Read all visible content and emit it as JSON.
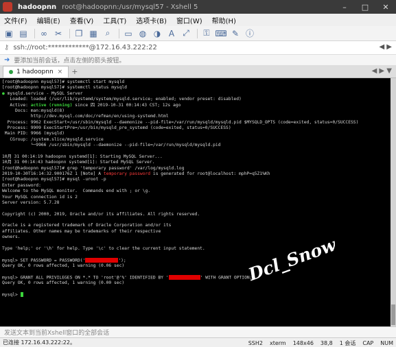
{
  "window": {
    "session": "hadoopnn",
    "title_path": "root@hadoopnn:/usr/mysql57 - Xshell 5",
    "controls": [
      "–",
      "□",
      "✕"
    ]
  },
  "menu": [
    "文件(F)",
    "编辑(E)",
    "查看(V)",
    "工具(T)",
    "选项卡(B)",
    "窗口(W)",
    "帮助(H)"
  ],
  "address": {
    "text": "ssh://root:************@172.16.43.222:22",
    "nav": "◀ ▶"
  },
  "hint": {
    "text": "要添加当前会话，点击左侧的箭头按钮。"
  },
  "tab": {
    "label": "1 hadoopnn",
    "close": "×",
    "add": "+",
    "nav": "◀ ▶ ▼"
  },
  "terminal": {
    "l1": "[root@hadoopnn mysql57]# systemctl start mysqld",
    "l2": "[root@hadoopnn mysql57]# systemctl status mysqld",
    "l3_dot": "●",
    "l3_rest": " mysqld.service - MySQL Server",
    "l4": "   Loaded: loaded (/usr/lib/systemd/system/mysqld.service; enabled; vendor preset: disabled)",
    "l5_a": "   Active: ",
    "l5_active": "active (running)",
    "l5_b": " since 四 2019-10-31 00:14:43 CST; 12s ago",
    "l6": "     Docs: man:mysqld(8)",
    "l7": "           http://dev.mysql.com/doc/refman/en/using-systemd.html",
    "l8": "  Process: 9962 ExecStart=/usr/sbin/mysqld --daemonize --pid-file=/var/run/mysqld/mysqld.pid $MYSQLD_OPTS (code=exited, status=0/SUCCESS)",
    "l9": "  Process: 9909 ExecStartPre=/usr/bin/mysqld_pre_systemd (code=exited, status=0/SUCCESS)",
    "l10": " Main PID: 9966 (mysqld)",
    "l11": "   CGroup: /system.slice/mysqld.service",
    "l12": "           └─9966 /usr/sbin/mysqld --daemonize --pid-file=/var/run/mysqld/mysqld.pid",
    "l13": "",
    "l14": "10月 31 00:14:19 hadoopnn systemd[1]: Starting MySQL Server...",
    "l15": "10月 31 00:14:43 hadoopnn systemd[1]: Started MySQL Server.",
    "l16": "[root@hadoopnn mysql57]# grep 'temporary password' /var/log/mysqld.log",
    "l17_a": "2019-10-30T16:14:32.900176Z 1 [Note] A ",
    "l17_red": "temporary password",
    "l17_b": " is generated for root@localhost: mphP=q5Z1%Kh",
    "l18": "[root@hadoopnn mysql57]# mysql -uroot -p",
    "l19": "Enter password:",
    "l20": "Welcome to the MySQL monitor.  Commands end with ; or \\g.",
    "l21": "Your MySQL connection id is 2",
    "l22": "Server version: 5.7.28",
    "l23": "",
    "l24": "Copyright (c) 2000, 2019, Oracle and/or its affiliates. All rights reserved.",
    "l25": "",
    "l26": "Oracle is a registered trademark of Oracle Corporation and/or its",
    "l27": "affiliates. Other names may be trademarks of their respective",
    "l28": "owners.",
    "l29": "",
    "l30": "Type 'help;' or '\\h' for help. Type '\\c' to clear the current input statement.",
    "l31": "",
    "l32_a": "mysql> SET PASSWORD = PASSWORD('",
    "l32_b": "');",
    "l33": "Query OK, 0 rows affected, 1 warning (0.06 sec)",
    "l34": "",
    "l35_a": "mysql> GRANT ALL PRIVILEGES ON *.* TO 'root'@'%' IDENTIFIED BY '",
    "l35_b": "' WITH GRANT OPTION;",
    "l36": "Query OK, 0 rows affected, 1 warning (0.00 sec)",
    "l37": "",
    "l38": "mysql> "
  },
  "watermark": "Dcl_Snow",
  "sendbar": {
    "text": "发送文本到当前Xshell窗口的全部会话"
  },
  "status": {
    "connection": "已连接 172.16.43.222:22。",
    "protocol": "SSH2",
    "terminal": "xterm",
    "size": "148x46",
    "position": "38,8",
    "sessions": "1 会话",
    "caps": "CAP",
    "num": "NUM"
  },
  "colors": {
    "terminal_bg": "#000000",
    "prompt_green": "#3ad33a",
    "redaction": "#e00000"
  }
}
